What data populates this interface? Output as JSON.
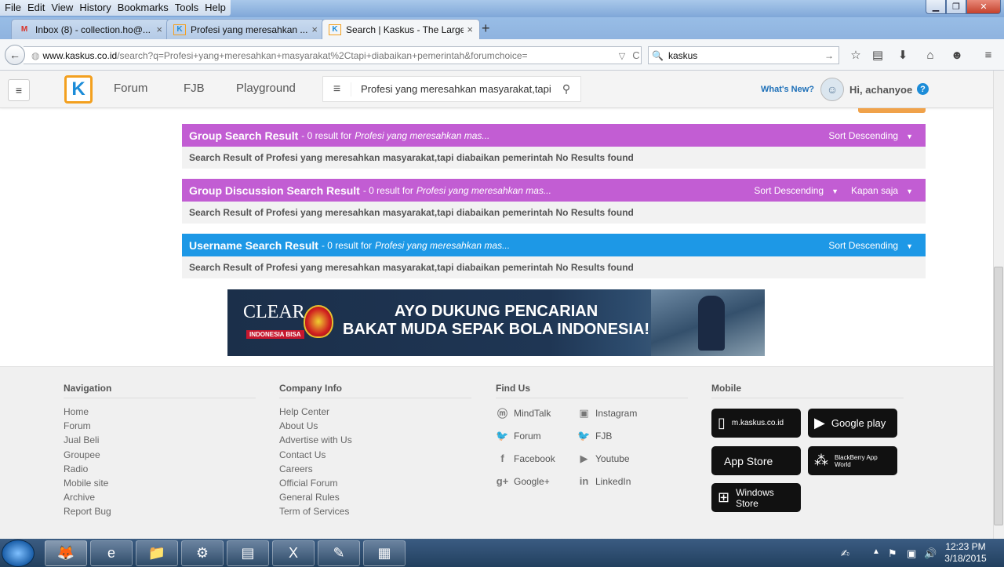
{
  "menu": [
    "File",
    "Edit",
    "View",
    "History",
    "Bookmarks",
    "Tools",
    "Help"
  ],
  "tabs": [
    {
      "title": "Inbox (8) - collection.ho@...",
      "icon": "gmail-icon"
    },
    {
      "title": "Profesi yang meresahkan ...",
      "icon": "kaskus-icon"
    },
    {
      "title": "Search | Kaskus - The Large...",
      "icon": "kaskus-icon"
    }
  ],
  "url": {
    "domain": "www.kaskus.co.id",
    "path": "/search?q=Profesi+yang+meresahkan+masyarakat%2Ctapi+diabaikan+pemerintah&forumchoice="
  },
  "browser_search": "kaskus",
  "site": {
    "nav": [
      "Forum",
      "FJB",
      "Playground"
    ],
    "search_value": "Profesi yang meresahkan masyarakat,tapi di",
    "whats_new": "What's New?",
    "greeting": "Hi, achanyoe",
    "help": "?"
  },
  "results": [
    {
      "title": "Group Search Result",
      "count": "- 0 result for",
      "query": "Profesi yang meresahkan mas...",
      "sorts": [
        "Sort Descending"
      ],
      "message": "Search Result of Profesi yang meresahkan masyarakat,tapi diabaikan pemerintah No Results found",
      "color": "#c25dd3"
    },
    {
      "title": "Group Discussion Search Result",
      "count": "- 0 result for",
      "query": "Profesi yang meresahkan mas...",
      "sorts": [
        "Sort Descending",
        "Kapan saja"
      ],
      "message": "Search Result of Profesi yang meresahkan masyarakat,tapi diabaikan pemerintah No Results found",
      "color": "#c25dd3"
    },
    {
      "title": "Username Search Result",
      "count": "- 0 result for",
      "query": "Profesi yang meresahkan mas...",
      "sorts": [
        "Sort Descending"
      ],
      "message": "Search Result of Profesi yang meresahkan masyarakat,tapi diabaikan pemerintah No Results found",
      "color": "#1d98e6"
    }
  ],
  "banner": {
    "brand": "CLEAR",
    "sub": "INDONESIA BISA",
    "line1": "AYO DUKUNG PENCARIAN",
    "line2": "BAKAT MUDA SEPAK BOLA INDONESIA!"
  },
  "footer": {
    "navigation": {
      "title": "Navigation",
      "links": [
        "Home",
        "Forum",
        "Jual Beli",
        "Groupee",
        "Radio",
        "Mobile site",
        "Archive",
        "Report Bug"
      ]
    },
    "company": {
      "title": "Company Info",
      "links": [
        "Help Center",
        "About Us",
        "Advertise with Us",
        "Contact Us",
        "Careers",
        "Official Forum",
        "General Rules",
        "Term of Services"
      ]
    },
    "findus": {
      "title": "Find Us",
      "left": [
        {
          "label": "MindTalk",
          "icon": "mindtalk-icon"
        },
        {
          "label": "Forum",
          "icon": "twitter-icon"
        },
        {
          "label": "Facebook",
          "icon": "facebook-icon"
        },
        {
          "label": "Google+",
          "icon": "googleplus-icon"
        }
      ],
      "right": [
        {
          "label": "Instagram",
          "icon": "instagram-icon"
        },
        {
          "label": "FJB",
          "icon": "twitter-icon"
        },
        {
          "label": "Youtube",
          "icon": "youtube-icon"
        },
        {
          "label": "LinkedIn",
          "icon": "linkedin-icon"
        }
      ]
    },
    "mobile": {
      "title": "Mobile",
      "badges": [
        "m.kaskus.co.id",
        "Google play",
        "App Store",
        "BlackBerry App World",
        "Windows Store"
      ]
    }
  },
  "taskbar": {
    "time": "12:23 PM",
    "date": "3/18/2015"
  }
}
